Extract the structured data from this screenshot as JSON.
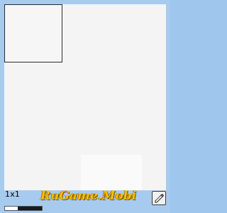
{
  "app": {
    "brand_logo_text": "RuGame.Mobi"
  },
  "status": {
    "size_label": "1x1",
    "progress_fraction": 0.35
  },
  "toolbar": {
    "edit_icon": "pencil-icon"
  },
  "colors": {
    "frame": "#a7cbef",
    "canvas": "#f4f4f4",
    "brand": "#f2c200"
  }
}
